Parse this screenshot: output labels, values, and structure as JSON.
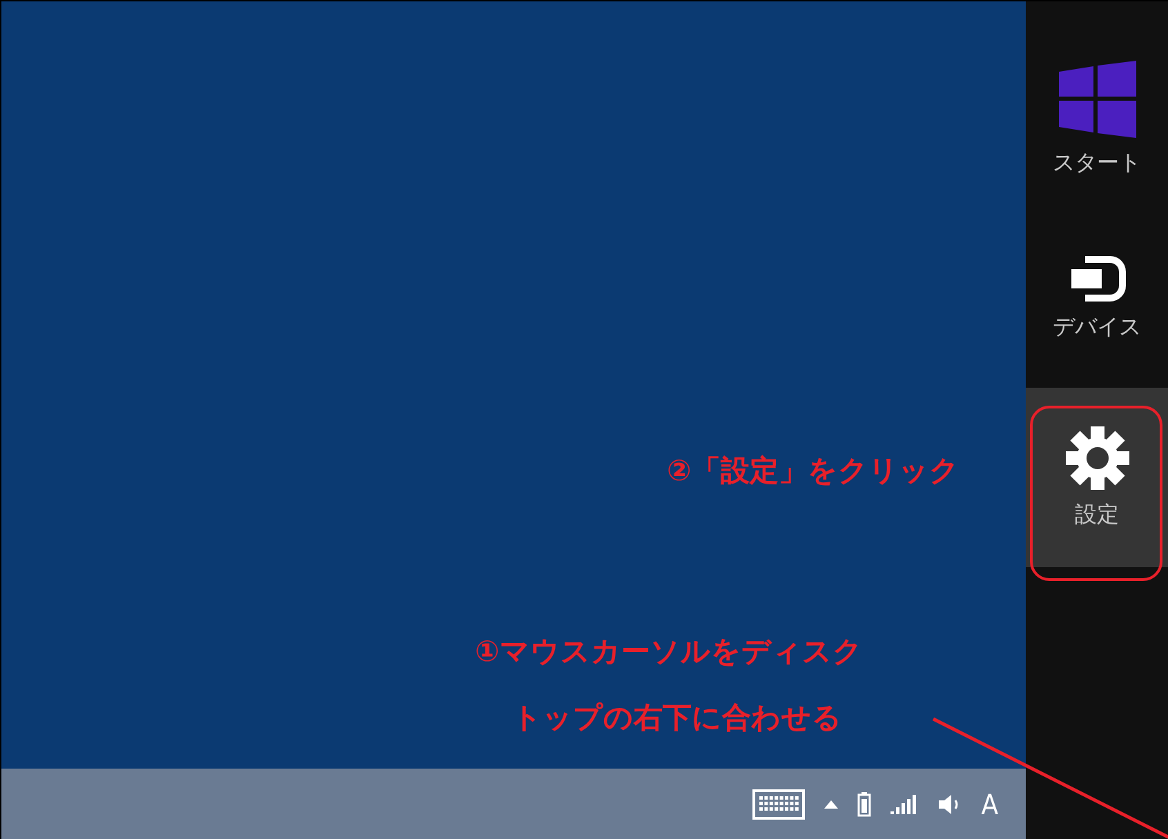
{
  "charms": [
    {
      "kind": "start",
      "label": "スタート",
      "selected": false
    },
    {
      "kind": "devices",
      "label": "デバイス",
      "selected": false
    },
    {
      "kind": "settings",
      "label": "設定",
      "selected": true
    }
  ],
  "taskbar": {
    "ime": "A"
  },
  "annotations": {
    "step2": "②「設定」をクリック",
    "step1": [
      "①マウスカーソルをディスク",
      "トップの右下に合わせる"
    ]
  }
}
